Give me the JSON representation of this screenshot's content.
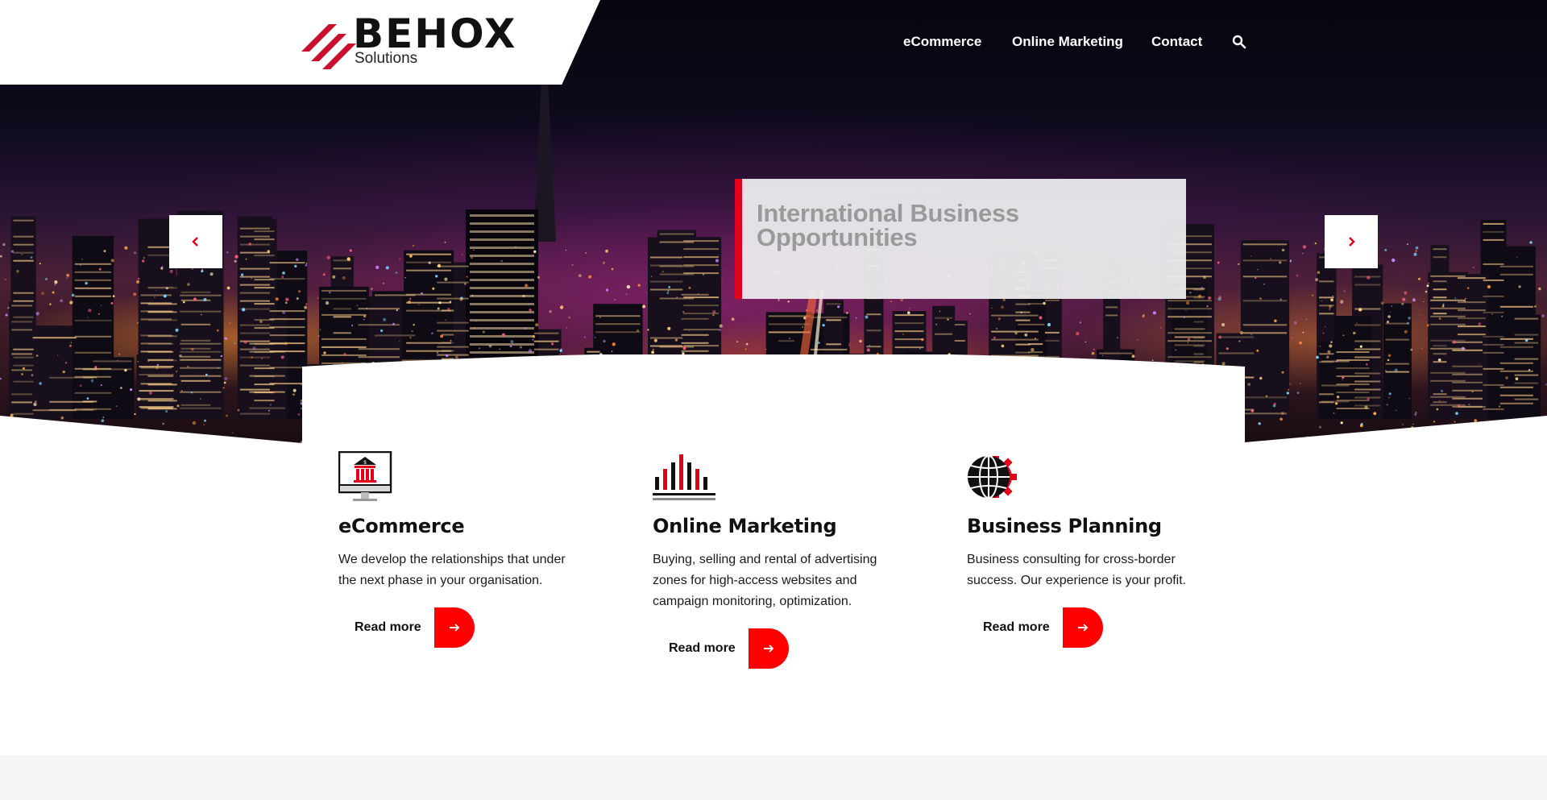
{
  "header": {
    "logo_text": "BEHOX",
    "logo_subtitle": "Solutions",
    "nav": [
      {
        "label": "eCommerce"
      },
      {
        "label": "Online Marketing"
      },
      {
        "label": "Contact"
      }
    ],
    "search_icon": "search-icon"
  },
  "slider": {
    "caption": "International Business Opportunities",
    "prev_icon": "chevron-left-icon",
    "next_icon": "chevron-right-icon",
    "accent_color": "#e3001b"
  },
  "services": [
    {
      "icon": "bank-monitor-icon",
      "title": "eCommerce",
      "description": "We develop the relationships that under the next phase in your organisation.",
      "button_label": "Read more"
    },
    {
      "icon": "bar-chart-icon",
      "title": "Online Marketing",
      "description": "Buying, selling and rental of advertising zones for high-access websites and campaign monitoring, optimization.",
      "button_label": "Read more"
    },
    {
      "icon": "globe-gear-icon",
      "title": "Business Planning",
      "description": "Business consulting for cross-border success. Our experience is your profit.",
      "button_label": "Read more"
    }
  ],
  "colors": {
    "brand_red": "#ff0000",
    "text_dark": "#111111",
    "caption_text": "#9a9a9a"
  }
}
